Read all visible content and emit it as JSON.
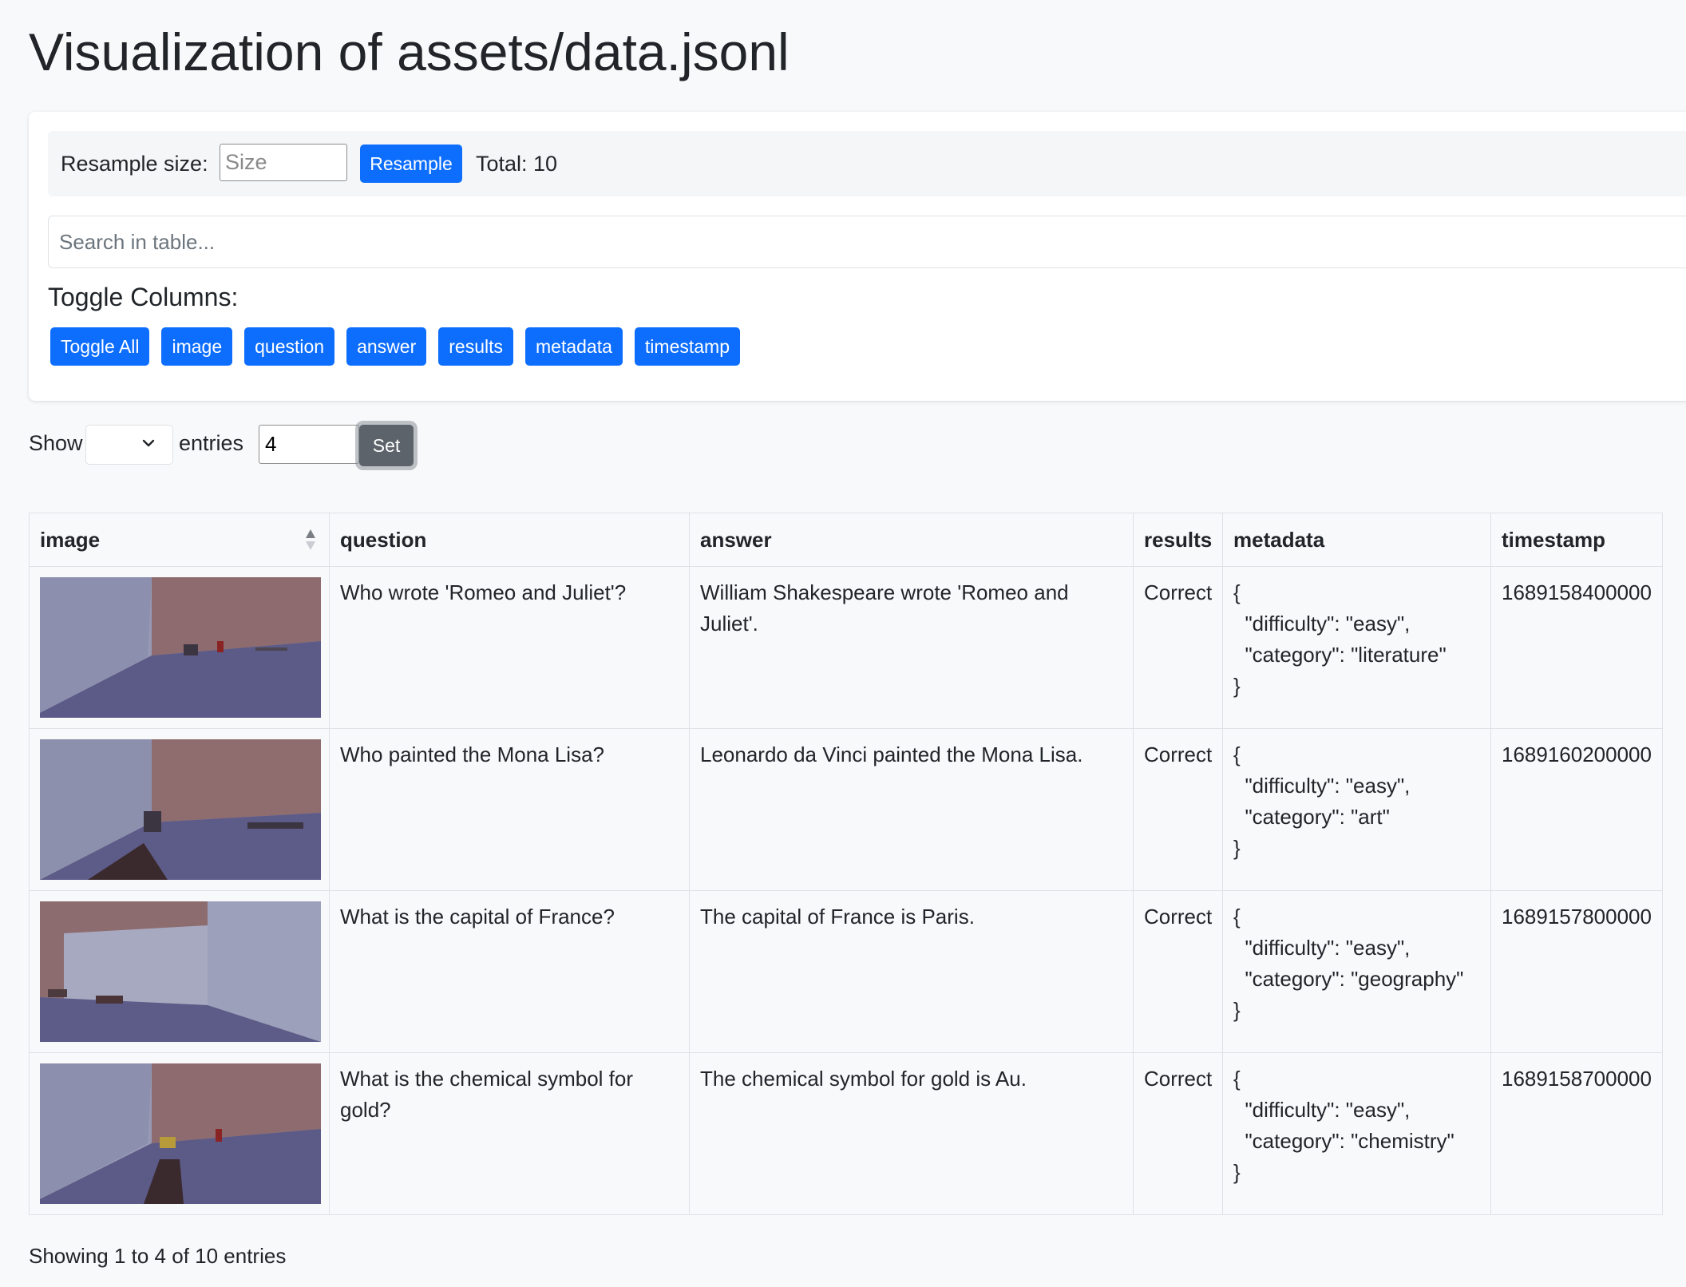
{
  "page": {
    "title": "Visualization of assets/data.jsonl"
  },
  "resample": {
    "label": "Resample size:",
    "placeholder": "Size",
    "button": "Resample",
    "total": "Total: 10"
  },
  "search": {
    "placeholder": "Search in table..."
  },
  "toggle": {
    "title": "Toggle Columns:",
    "buttons": [
      "Toggle All",
      "image",
      "question",
      "answer",
      "results",
      "metadata",
      "timestamp"
    ]
  },
  "entries": {
    "show_label": "Show",
    "entries_label": "entries",
    "value": "4",
    "set_button": "Set"
  },
  "table": {
    "columns": [
      "image",
      "question",
      "answer",
      "results",
      "metadata",
      "timestamp"
    ],
    "rows": [
      {
        "question": "Who wrote 'Romeo and Juliet'?",
        "answer": "William Shakespeare wrote 'Romeo and Juliet'.",
        "results": "Correct",
        "metadata": "{\n  \"difficulty\": \"easy\",\n  \"category\": \"literature\"\n}",
        "timestamp": "1689158400000"
      },
      {
        "question": "Who painted the Mona Lisa?",
        "answer": "Leonardo da Vinci painted the Mona Lisa.",
        "results": "Correct",
        "metadata": "{\n  \"difficulty\": \"easy\",\n  \"category\": \"art\"\n}",
        "timestamp": "1689160200000"
      },
      {
        "question": "What is the capital of France?",
        "answer": "The capital of France is Paris.",
        "results": "Correct",
        "metadata": "{\n  \"difficulty\": \"easy\",\n  \"category\": \"geography\"\n}",
        "timestamp": "1689157800000"
      },
      {
        "question": "What is the chemical symbol for gold?",
        "answer": "The chemical symbol for gold is Au.",
        "results": "Correct",
        "metadata": "{\n  \"difficulty\": \"easy\",\n  \"category\": \"chemistry\"\n}",
        "timestamp": "1689158700000"
      }
    ]
  },
  "footer": {
    "info": "Showing 1 to 4 of 10 entries"
  },
  "colors": {
    "primary": "#0d6efd",
    "secondary": "#5c636a",
    "background": "#f8f9fa"
  }
}
